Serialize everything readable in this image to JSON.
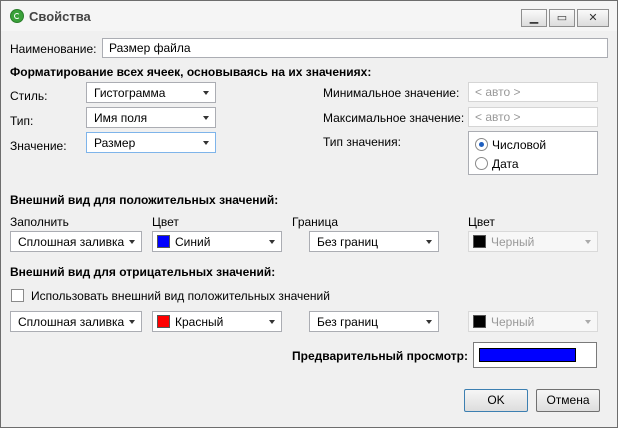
{
  "window": {
    "title": "Свойства",
    "controls": {
      "minimize": "▁",
      "maximize": "▭",
      "close": "✕"
    }
  },
  "name_field": {
    "label": "Наименование:",
    "value": "Размер файла"
  },
  "format_section": {
    "heading": "Форматирование всех ячеек, основываясь на их значениях:",
    "style_label": "Стиль:",
    "style_value": "Гистограмма",
    "type_label": "Тип:",
    "type_value": "Имя поля",
    "value_label": "Значение:",
    "value_value": "Размер",
    "min_label": "Минимальное значение:",
    "min_placeholder": "< авто >",
    "max_label": "Максимальное значение:",
    "max_placeholder": "< авто >",
    "value_type_label": "Тип значения:",
    "value_type_options": [
      "Числовой",
      "Дата"
    ],
    "value_type_selected": "Числовой"
  },
  "positive_section": {
    "heading": "Внешний вид для положительных значений:",
    "fill_label": "Заполнить",
    "color_label": "Цвет",
    "border_label": "Граница",
    "border_color_label": "Цвет",
    "fill_value": "Сплошная заливка",
    "color_value": "Синий",
    "color_hex": "#0000ff",
    "border_value": "Без границ",
    "border_color_value": "Черный",
    "border_color_hex": "#000000"
  },
  "negative_section": {
    "heading": "Внешний вид для отрицательных значений:",
    "use_positive_label": "Использовать внешний вид положительных значений",
    "use_positive_checked": false,
    "fill_value": "Сплошная заливка",
    "color_value": "Красный",
    "color_hex": "#ff0000",
    "border_value": "Без границ",
    "border_color_value": "Черный",
    "border_color_hex": "#000000"
  },
  "preview": {
    "label": "Предварительный просмотр:",
    "bar_color": "#0000ff"
  },
  "buttons": {
    "ok": "OK",
    "cancel": "Отмена"
  }
}
